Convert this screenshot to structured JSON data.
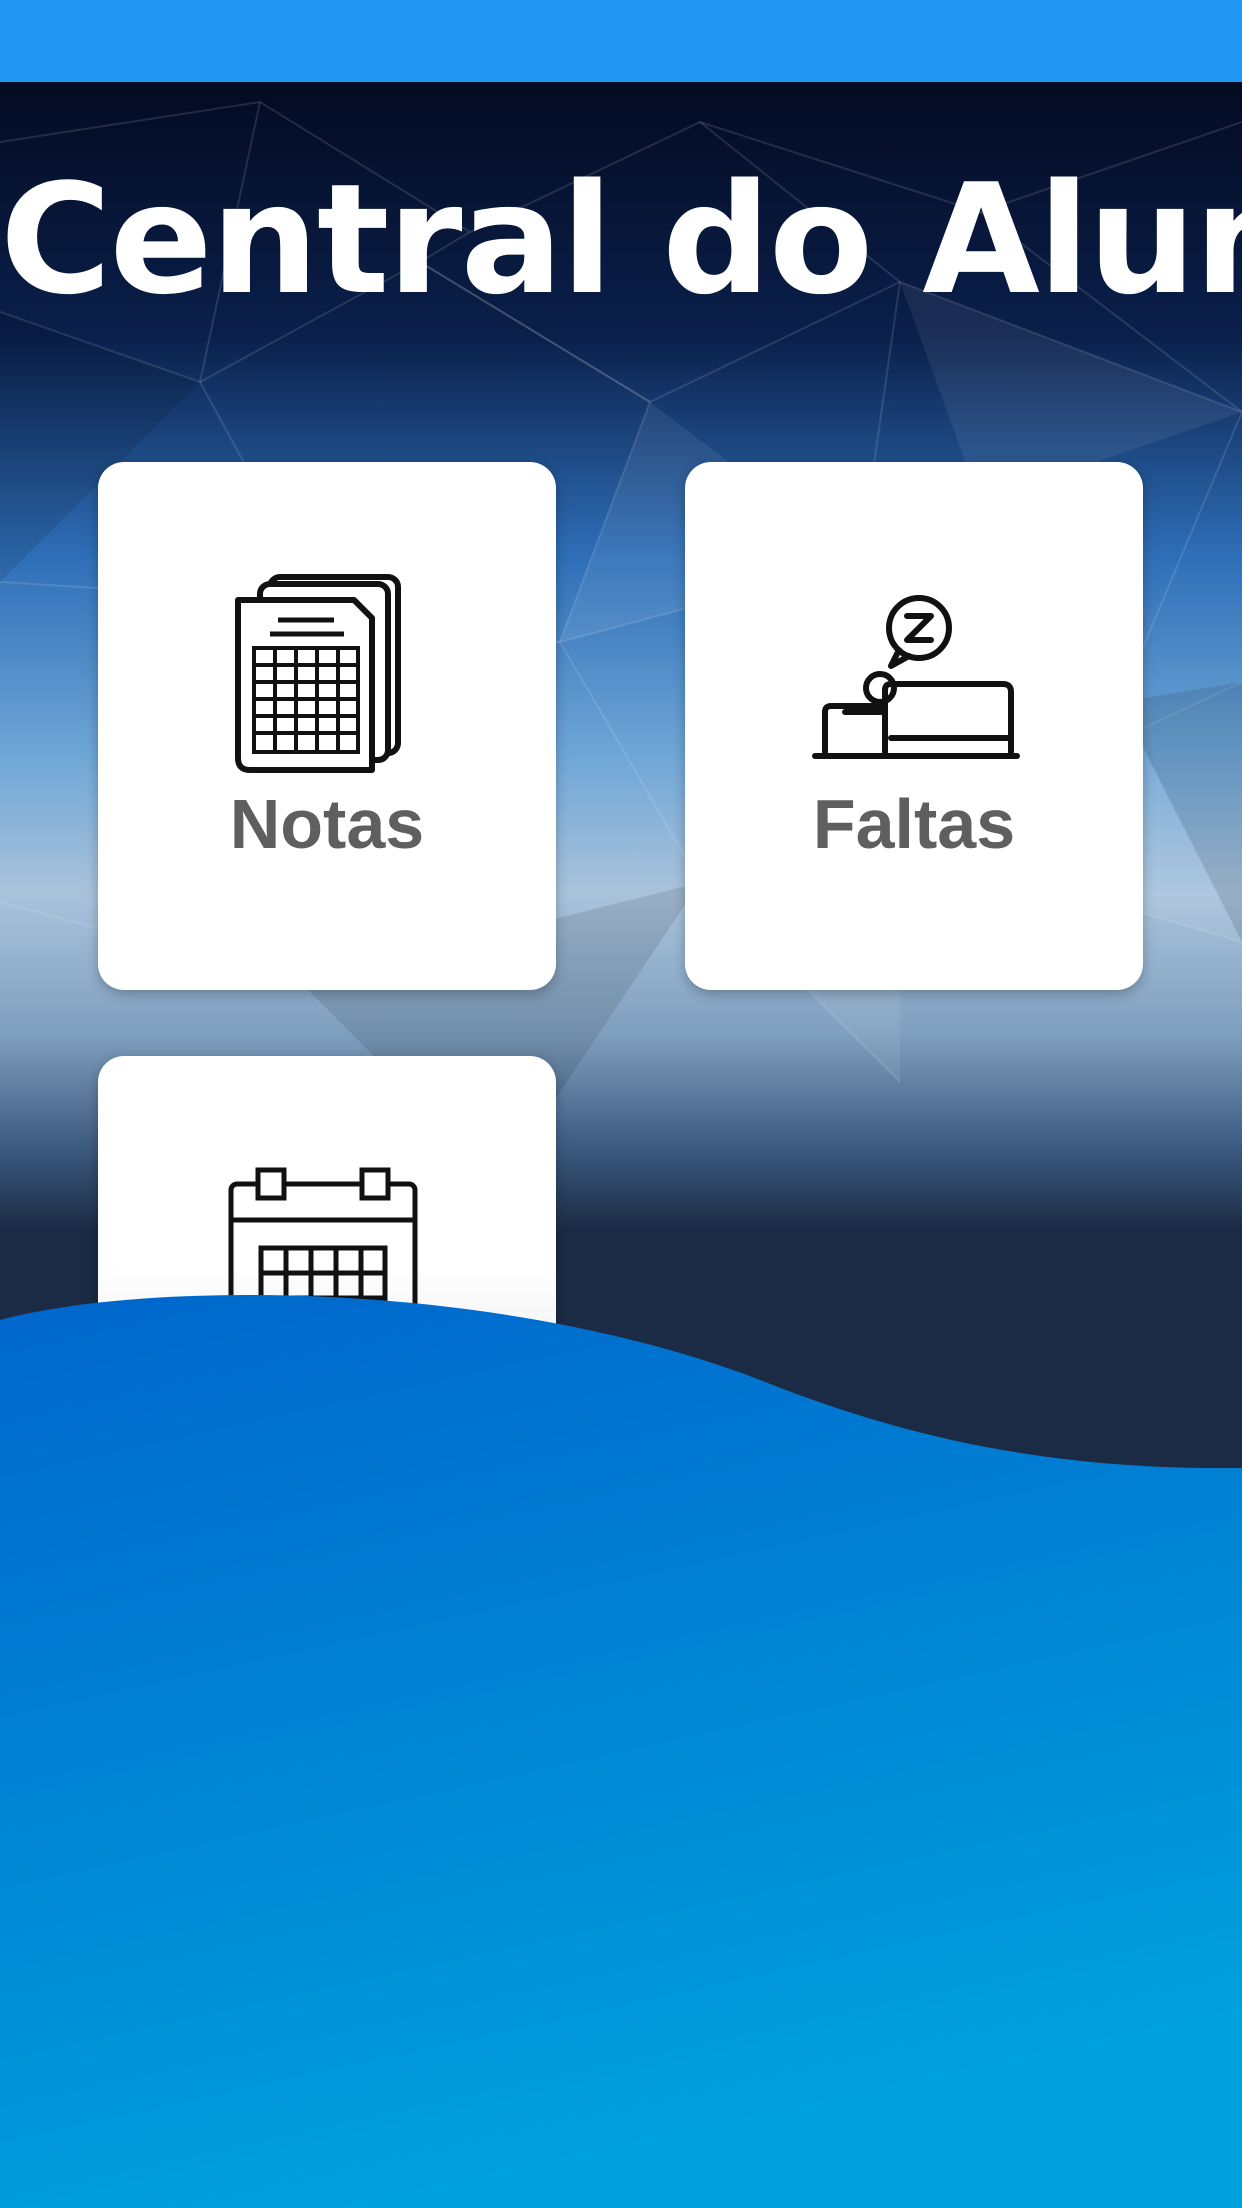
{
  "app": {
    "title": "Central do Aluno"
  },
  "menu": {
    "items": [
      {
        "label": "Notas",
        "icon": "grades-document-icon"
      },
      {
        "label": "Faltas",
        "icon": "absence-bed-icon"
      },
      {
        "label": "",
        "icon": "calendar-icon"
      }
    ]
  },
  "colors": {
    "status_bar": "#2196f3",
    "wave_top": "#0066cc",
    "wave_bottom": "#00a0dc",
    "tile_label": "#5f5f5f"
  }
}
